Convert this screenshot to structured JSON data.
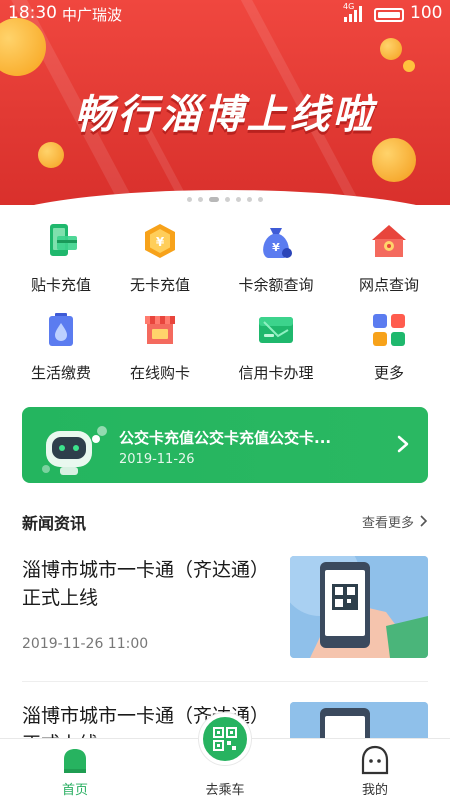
{
  "status_bar": {
    "time": "18:30",
    "carrier": "中广瑞波",
    "network": "4G",
    "battery": "100"
  },
  "banner": {
    "title": "畅行淄博上线啦",
    "pager_count": 8,
    "pager_active": 3
  },
  "grid": [
    {
      "label": "贴卡充值",
      "icon": "phone-card-icon"
    },
    {
      "label": "无卡充值",
      "icon": "yuan-badge-icon"
    },
    {
      "label": "卡余额查询",
      "icon": "money-bag-icon"
    },
    {
      "label": "网点查询",
      "icon": "location-house-icon"
    },
    {
      "label": "生活缴费",
      "icon": "water-drop-bill-icon"
    },
    {
      "label": "在线购卡",
      "icon": "shop-icon"
    },
    {
      "label": "信用卡办理",
      "icon": "credit-card-icon"
    },
    {
      "label": "更多",
      "icon": "more-apps-icon"
    }
  ],
  "promo_card": {
    "title": "公交卡充值公交卡充值公交卡...",
    "date": "2019-11-26",
    "colors": {
      "bg": "#27b360"
    }
  },
  "news": {
    "heading": "新闻资讯",
    "more_label": "查看更多",
    "items": [
      {
        "title": "淄博市城市一卡通（齐达通）正式上线",
        "date": "2019-11-26 11:00"
      },
      {
        "title": "淄博市城市一卡通（齐达通）正式上线",
        "date": ""
      }
    ]
  },
  "bottom_nav": [
    {
      "label": "首页",
      "icon": "home-icon",
      "active": true
    },
    {
      "label": "去乘车",
      "icon": "qr-code-icon",
      "active": false
    },
    {
      "label": "我的",
      "icon": "profile-face-icon",
      "active": false
    }
  ],
  "colors": {
    "accent": "#27b360",
    "banner_red": "#e23a34"
  }
}
